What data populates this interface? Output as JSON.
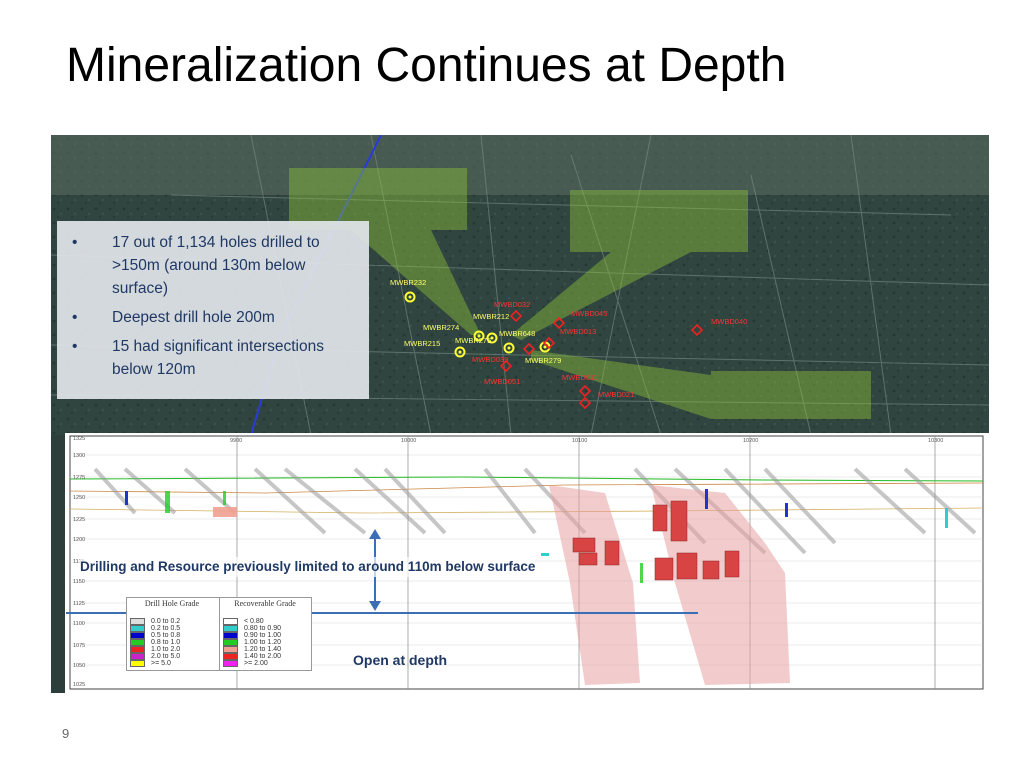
{
  "slide": {
    "title": "Mineralization Continues at Depth",
    "page_number": "9"
  },
  "bullets": [
    "17 out of 1,134 holes drilled to >150m (around 130m below surface)",
    "Deepest drill hole 200m",
    "15 had significant intersections below 120m"
  ],
  "map_labels": {
    "holes_yellow": [
      "MWBR232",
      "MWBR212",
      "MWBR274",
      "MWBR648",
      "MWBR275",
      "MWBR215",
      "MWBR279"
    ],
    "holes_red": [
      "MWBD032",
      "MWBD045",
      "MWBD013",
      "MWBD040",
      "MWBD039",
      "MWBD051",
      "MWBD011",
      "MWBD021"
    ]
  },
  "section": {
    "note_limited": "Drilling and Resource previously limited to around 110m below surface",
    "note_open": "Open at depth",
    "y_ticks": [
      "1325",
      "1300",
      "1275",
      "1250",
      "1225",
      "1200",
      "1175",
      "1150",
      "1125",
      "1100",
      "1075",
      "1050",
      "1025"
    ],
    "x_ticks": [
      "9900",
      "10000",
      "10100",
      "10200",
      "10300"
    ]
  },
  "legend": {
    "drill_title": "Drill Hole Grade",
    "drill_items": [
      "0.0 to 0.2",
      "0.2 to 0.5",
      "0.5 to 0.8",
      "0.8 to 1.0",
      "1.0 to 2.0",
      "2.0 to 5.0",
      ">= 5.0"
    ],
    "drill_colors": [
      "#dddddd",
      "#33cccc",
      "#0000cc",
      "#22cc22",
      "#ee2222",
      "#cc22cc",
      "#ffff00"
    ],
    "rec_title": "Recoverable Grade",
    "rec_items": [
      "< 0.80",
      "0.80 to 0.90",
      "0.90 to 1.00",
      "1.00 to 1.20",
      "1.20 to 1.40",
      "1.40 to 2.00",
      ">= 2.00"
    ],
    "rec_colors": [
      "#ffffff",
      "#33cccc",
      "#0000cc",
      "#22cc22",
      "#f0a090",
      "#ee2222",
      "#ee22ee"
    ]
  }
}
